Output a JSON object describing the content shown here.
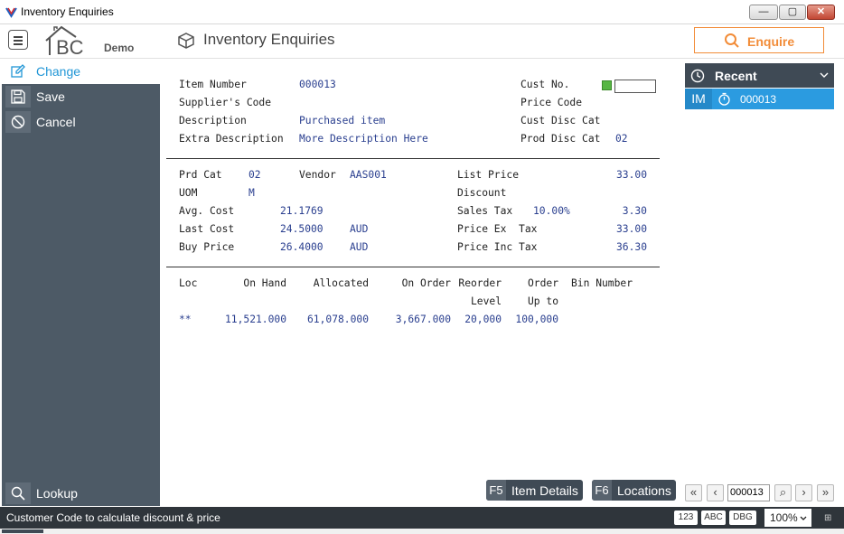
{
  "window": {
    "title": "Inventory Enquiries",
    "controls": {
      "minimize": "—",
      "maximize": "▢",
      "close": "✕"
    }
  },
  "header": {
    "logo_text": "BC",
    "logo_tag": "Demo",
    "page_title": "Inventory Enquiries",
    "enquire_label": "Enquire",
    "accent": "#f28c38"
  },
  "sidebar": {
    "items": [
      {
        "label": "Change",
        "icon": "edit-icon",
        "active": true
      },
      {
        "label": "Save",
        "icon": "save-icon"
      },
      {
        "label": "Cancel",
        "icon": "cancel-icon"
      }
    ],
    "lookup_label": "Lookup"
  },
  "item": {
    "labels": {
      "item_number": "Item Number",
      "supplier_code": "Supplier's Code",
      "description": "Description",
      "extra_description": "Extra Description",
      "cust_no": "Cust No.",
      "price_code": "Price Code",
      "cust_disc_cat": "Cust Disc Cat",
      "prod_disc_cat": "Prod Disc Cat"
    },
    "values": {
      "item_number": "000013",
      "description": "Purchased item",
      "extra_description": "More Description Here",
      "prod_disc_cat": "02",
      "cust_no": ""
    }
  },
  "pricing": {
    "labels": {
      "prd_cat": "Prd Cat",
      "vendor": "Vendor",
      "uom": "UOM",
      "avg_cost": "Avg. Cost",
      "last_cost": "Last Cost",
      "buy_price": "Buy Price",
      "list_price": "List Price",
      "discount": "Discount",
      "sales_tax": "Sales Tax",
      "price_ex_tax": "Price Ex  Tax",
      "price_inc_tax": "Price Inc Tax"
    },
    "values": {
      "prd_cat": "02",
      "vendor": "AAS001",
      "uom": "M",
      "avg_cost": "21.1769",
      "last_cost": "24.5000",
      "last_cost_currency": "AUD",
      "buy_price": "26.4000",
      "buy_price_currency": "AUD",
      "list_price": "33.00",
      "sales_tax_rate": "10.00%",
      "sales_tax": "3.30",
      "price_ex_tax": "33.00",
      "price_inc_tax": "36.30"
    }
  },
  "stock": {
    "headers": {
      "loc": "Loc",
      "on_hand": "On Hand",
      "allocated": "Allocated",
      "on_order": "On Order",
      "reorder_1": "Reorder",
      "reorder_2": "Level",
      "order_1": "Order",
      "order_2": "Up to",
      "bin": "Bin Number"
    },
    "rows": [
      {
        "loc": "**",
        "on_hand": "11,521.000",
        "allocated": "61,078.000",
        "on_order": "3,667.000",
        "reorder": "20,000",
        "order_up_to": "100,000",
        "bin": ""
      }
    ]
  },
  "function_keys": [
    {
      "key": "F5",
      "label": "Item Details"
    },
    {
      "key": "F6",
      "label": "Locations"
    }
  ],
  "recent": {
    "title": "Recent",
    "items": [
      {
        "prefix": "IM",
        "value": "000013"
      }
    ]
  },
  "navigator": {
    "first": "«",
    "prev": "‹",
    "value": "000013",
    "search": "⌕",
    "next": "›",
    "last": "»"
  },
  "status": {
    "message": "Customer Code to calculate discount & price",
    "modes": [
      "123",
      "ABC",
      "DBG"
    ],
    "zoom": "100%"
  }
}
